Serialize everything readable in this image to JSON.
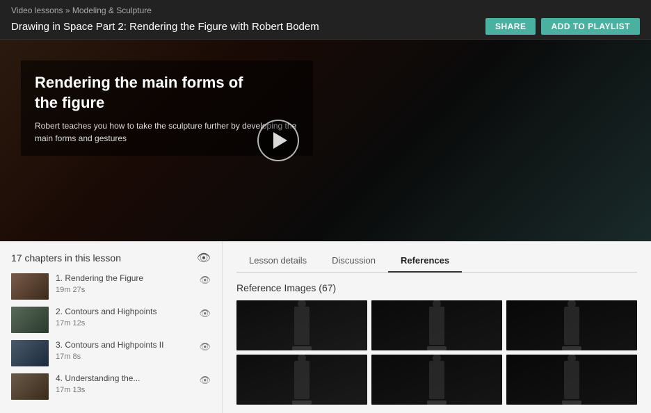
{
  "header": {
    "breadcrumb_part1": "Video lessons",
    "breadcrumb_separator": " » ",
    "breadcrumb_part2": "Modeling & Sculpture",
    "page_title": "Drawing in Space Part 2: Rendering the Figure with Robert Bodem",
    "share_label": "SHARE",
    "playlist_label": "ADD TO PLAYLIST"
  },
  "video": {
    "main_title_line1": "Rendering the main forms of",
    "main_title_line2": "the figure",
    "description": "Robert teaches you how to take the sculpture further by developing the main forms and gestures"
  },
  "sidebar": {
    "title": "17 chapters in this lesson",
    "chapters": [
      {
        "number": "1.",
        "name": "Rendering the Figure",
        "duration": "19m 27s"
      },
      {
        "number": "2.",
        "name": "Contours and Highpoints",
        "duration": "17m 12s"
      },
      {
        "number": "3.",
        "name": "Contours and Highpoints II",
        "duration": "17m 8s"
      },
      {
        "number": "4.",
        "name": "Understanding the...",
        "duration": "17m 13s"
      }
    ]
  },
  "tabs": [
    {
      "id": "lesson-details",
      "label": "Lesson details"
    },
    {
      "id": "discussion",
      "label": "Discussion"
    },
    {
      "id": "references",
      "label": "References",
      "active": true
    }
  ],
  "references": {
    "heading": "Reference Images (67)",
    "images": [
      {
        "id": 1
      },
      {
        "id": 2
      },
      {
        "id": 3
      },
      {
        "id": 4
      },
      {
        "id": 5
      },
      {
        "id": 6
      }
    ]
  },
  "icons": {
    "eye": "👁",
    "play": "▶"
  }
}
